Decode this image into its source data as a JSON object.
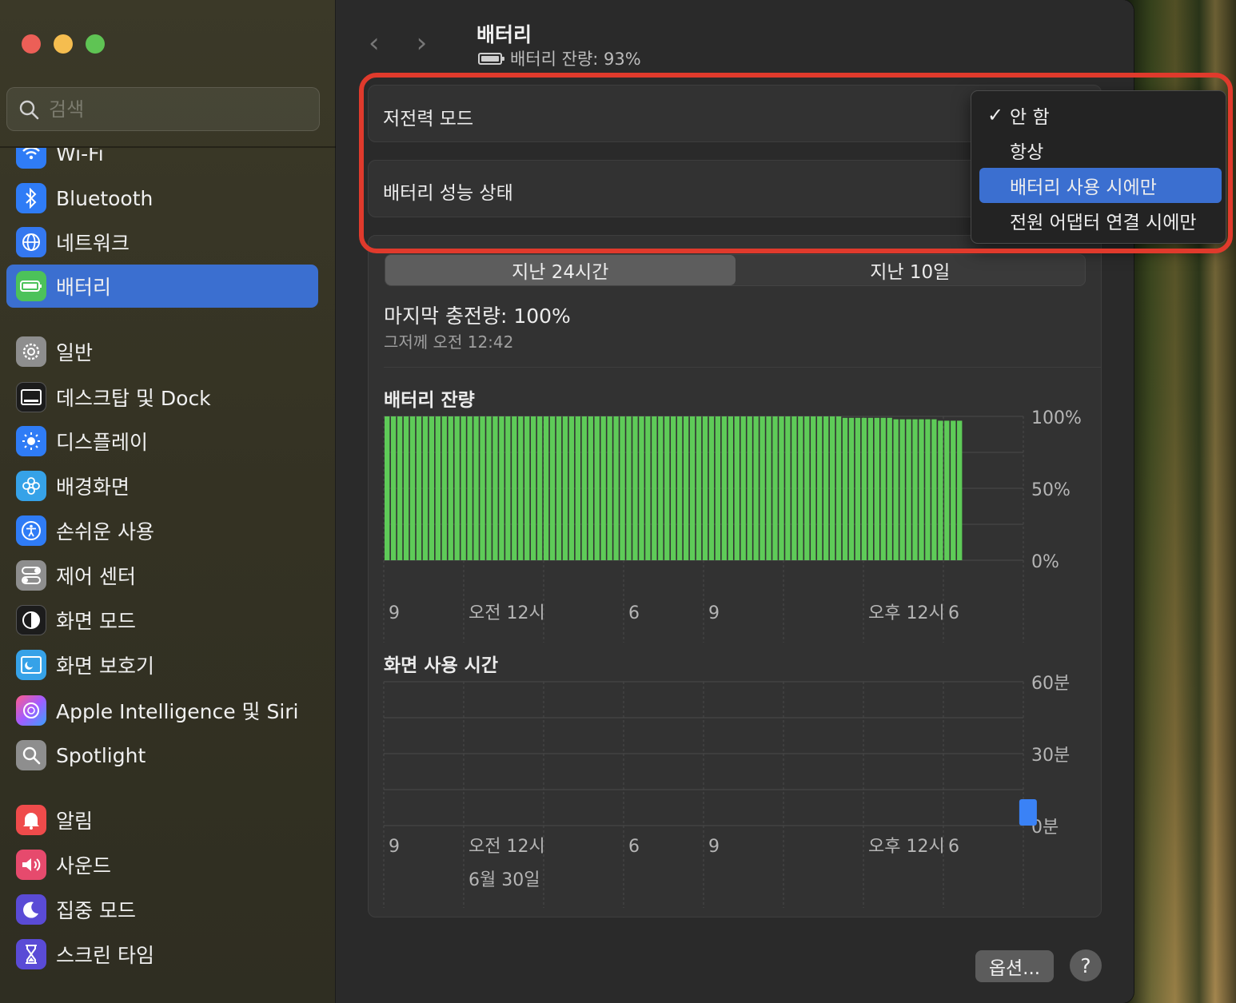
{
  "window": {
    "controls": [
      "close",
      "minimize",
      "zoom"
    ]
  },
  "search": {
    "placeholder": "검색"
  },
  "sidebar": {
    "items": [
      {
        "label": "Wi-Fi",
        "icon": "wifi-icon",
        "color": "#2f7cf6"
      },
      {
        "label": "Bluetooth",
        "icon": "bluetooth-icon",
        "color": "#2f7cf6"
      },
      {
        "label": "네트워크",
        "icon": "globe-icon",
        "color": "#3478f0"
      },
      {
        "label": "배터리",
        "icon": "battery-icon",
        "color": "#4cc25a",
        "active": true
      },
      {
        "label": "일반",
        "icon": "gear-icon",
        "color": "#8e8e8e"
      },
      {
        "label": "데스크탑 및 Dock",
        "icon": "dock-icon",
        "color": "#1c1c1c"
      },
      {
        "label": "디스플레이",
        "icon": "sun-icon",
        "color": "#2f7cf6"
      },
      {
        "label": "배경화면",
        "icon": "flower-icon",
        "color": "#36a2e8"
      },
      {
        "label": "손쉬운 사용",
        "icon": "accessibility-icon",
        "color": "#2f7cf6"
      },
      {
        "label": "제어 센터",
        "icon": "toggles-icon",
        "color": "#8e8e8e"
      },
      {
        "label": "화면 모드",
        "icon": "appearance-icon",
        "color": "#1c1c1c"
      },
      {
        "label": "화면 보호기",
        "icon": "screensaver-icon",
        "color": "#36a2e8"
      },
      {
        "label": "Apple Intelligence 및 Siri",
        "icon": "siri-icon",
        "color": "#a35cff"
      },
      {
        "label": "Spotlight",
        "icon": "magnifier-icon",
        "color": "#8e8e8e"
      },
      {
        "label": "알림",
        "icon": "bell-icon",
        "color": "#ef4b4b"
      },
      {
        "label": "사운드",
        "icon": "speaker-icon",
        "color": "#e64a6d"
      },
      {
        "label": "집중 모드",
        "icon": "moon-icon",
        "color": "#5a4bd6"
      },
      {
        "label": "스크린 타임",
        "icon": "hourglass-icon",
        "color": "#5a4bd6"
      }
    ]
  },
  "header": {
    "title": "배터리",
    "subtitle": "배터리 잔량: 93%"
  },
  "settings": {
    "low_power_label": "저전력 모드",
    "health_label": "배터리 성능 상태"
  },
  "dropdown": {
    "options": [
      "안 함",
      "항상",
      "배터리 사용 시에만",
      "전원 어댑터 연결 시에만"
    ],
    "checked_index": 0,
    "highlighted_index": 2
  },
  "tabs": {
    "day": "지난 24시간",
    "ten_days": "지난 10일",
    "selected": "day"
  },
  "last_charge": {
    "label": "마지막 충전량: 100%",
    "time": "그저께 오전 12:42"
  },
  "battery_chart_title": "배터리 잔량",
  "screen_chart_title": "화면 사용 시간",
  "footer": {
    "options_label": "옵션...",
    "help_label": "?"
  },
  "chart_data": [
    {
      "type": "bar",
      "title": "배터리 잔량",
      "ylim": [
        0,
        100
      ],
      "y_ticks": [
        "100%",
        "50%",
        "0%"
      ],
      "x_tick_labels": [
        "9",
        "오전 12시",
        "6",
        "9",
        "오후 12시",
        "6"
      ],
      "bar_count": 91,
      "series": [
        {
          "color": "#5ecb58",
          "values_note": "all ~100%, last few ~97-98%"
        }
      ],
      "values": [
        100,
        100,
        100,
        100,
        100,
        100,
        100,
        100,
        100,
        100,
        100,
        100,
        100,
        100,
        100,
        100,
        100,
        100,
        100,
        100,
        100,
        100,
        100,
        100,
        100,
        100,
        100,
        100,
        100,
        100,
        100,
        100,
        100,
        100,
        100,
        100,
        100,
        100,
        100,
        100,
        100,
        100,
        100,
        100,
        100,
        100,
        100,
        100,
        100,
        100,
        100,
        100,
        100,
        100,
        100,
        100,
        100,
        100,
        100,
        100,
        100,
        100,
        100,
        100,
        100,
        100,
        100,
        100,
        100,
        100,
        100,
        100,
        99,
        99,
        99,
        99,
        99,
        99,
        99,
        99,
        98,
        98,
        98,
        98,
        98,
        98,
        98,
        97,
        97,
        97,
        97
      ]
    },
    {
      "type": "bar",
      "title": "화면 사용 시간",
      "ylim": [
        0,
        60
      ],
      "y_ticks": [
        "60분",
        "30분",
        "0분"
      ],
      "x_tick_labels": [
        "9",
        "오전 12시",
        "6",
        "9",
        "오후 12시",
        "6"
      ],
      "date_label": "6월 30일",
      "series": [
        {
          "color": "#3a82f6"
        }
      ],
      "bars": [
        {
          "slot": 71,
          "value": 11
        }
      ]
    }
  ]
}
